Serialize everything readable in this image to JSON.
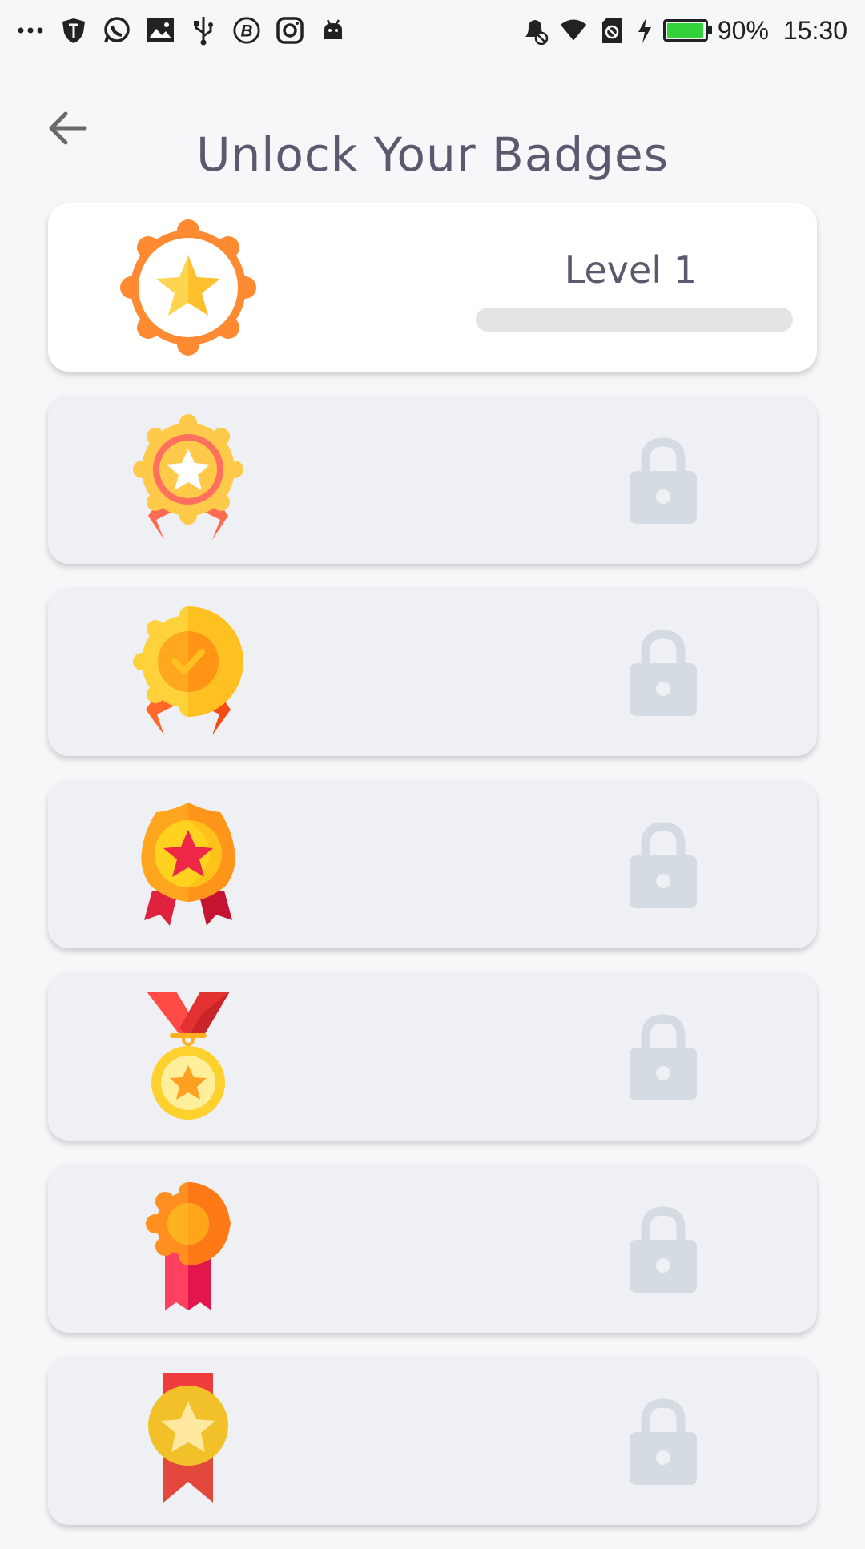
{
  "status_bar": {
    "left_icons": [
      "more-dots-icon",
      "shield-icon",
      "whatsapp-icon",
      "image-icon",
      "usb-icon",
      "bitcoin-icon",
      "instagram-icon",
      "android-icon"
    ],
    "right_icons": [
      "alarm-off-icon",
      "wifi-icon",
      "sim-icon",
      "charging-icon"
    ],
    "battery_percent": "90%",
    "battery_level": 0.9,
    "time": "15:30"
  },
  "header": {
    "title": "Unlock Your Badges"
  },
  "badges": [
    {
      "state": "unlocked",
      "level_label": "Level 1",
      "progress": 0.0,
      "icon": "orange-star-medal-icon"
    },
    {
      "state": "locked",
      "icon": "red-star-ribbon-medal-icon"
    },
    {
      "state": "locked",
      "icon": "gold-check-ribbon-medal-icon"
    },
    {
      "state": "locked",
      "icon": "red-star-seal-medal-icon"
    },
    {
      "state": "locked",
      "icon": "neck-ribbon-medal-icon"
    },
    {
      "state": "locked",
      "icon": "flower-ribbon-medal-icon"
    },
    {
      "state": "locked",
      "icon": "gold-star-banner-medal-icon"
    }
  ],
  "colors": {
    "background": "#f6f7f9",
    "card_locked": "#eef0f4",
    "card_unlocked": "#ffffff",
    "lock": "#d5dbe3",
    "title_text": "#5a5a6e",
    "battery_fill": "#33d13a"
  }
}
